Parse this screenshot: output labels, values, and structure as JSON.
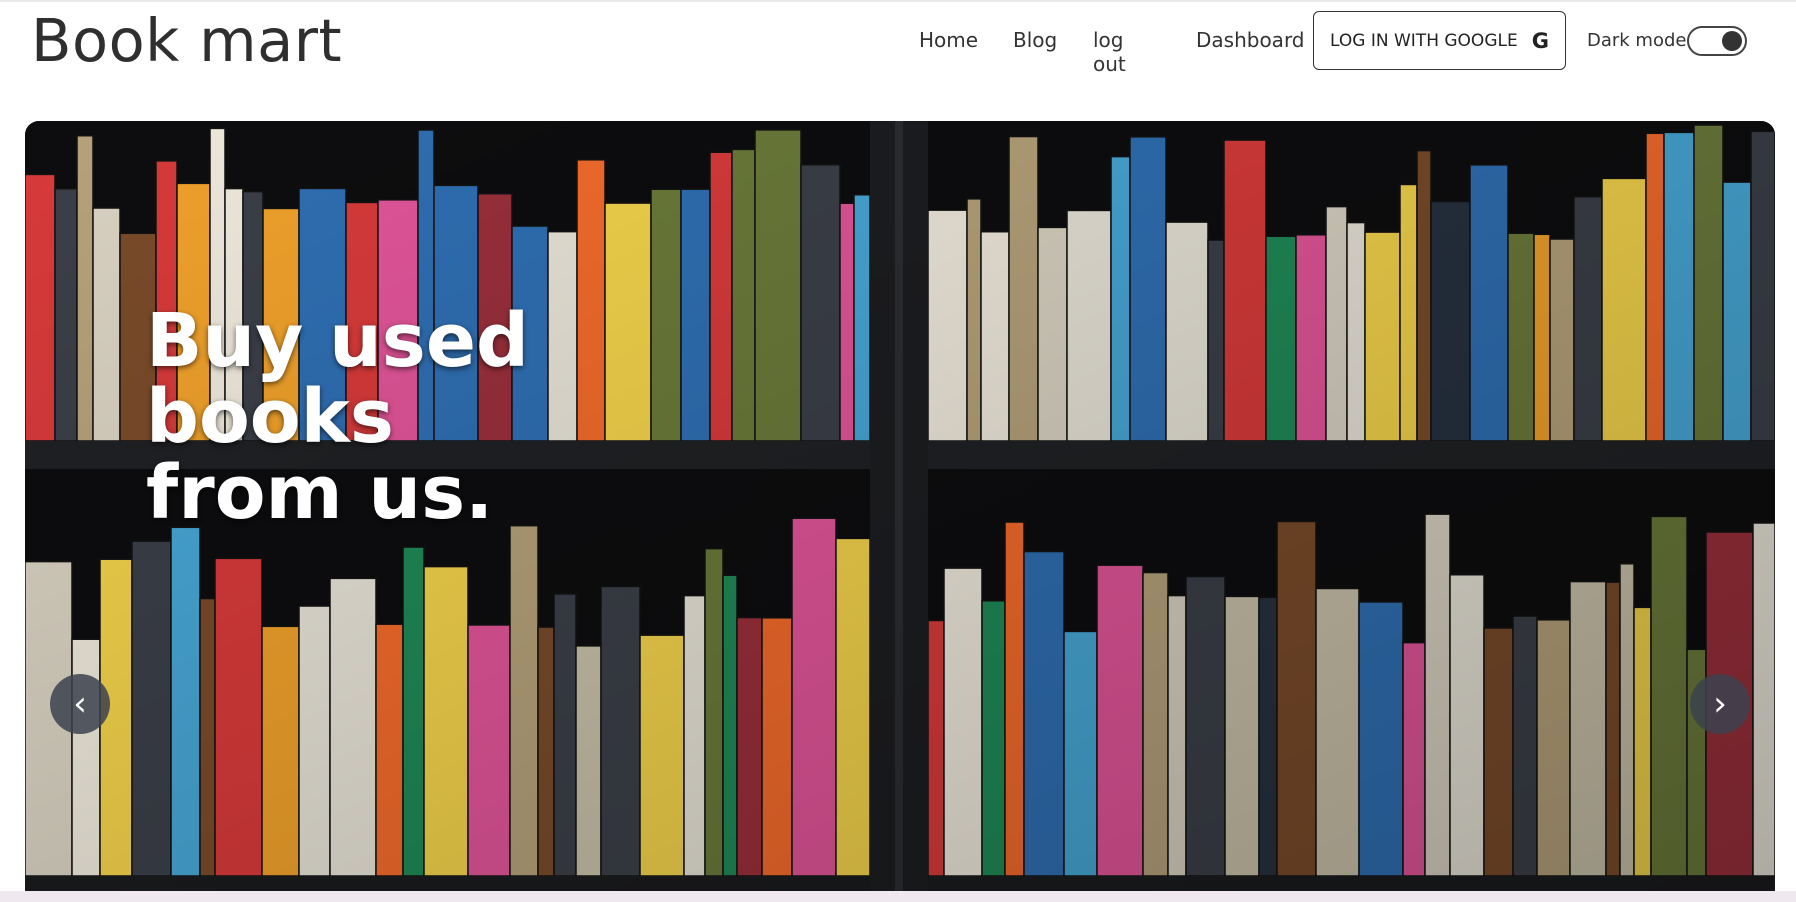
{
  "brand": "Book mart",
  "nav": {
    "home": "Home",
    "blog": "Blog",
    "logout": "log out",
    "dashboard": "Dashboard",
    "login_google": "LOG IN WITH GOOGLE",
    "google_glyph": "G",
    "dark_mode_label": "Dark mode",
    "dark_mode_on": true
  },
  "hero": {
    "caption": "Buy used books from us.",
    "prev_glyph": "‹",
    "next_glyph": "›",
    "icons": {
      "prev": "chevron-left-icon",
      "next": "chevron-right-icon"
    }
  }
}
